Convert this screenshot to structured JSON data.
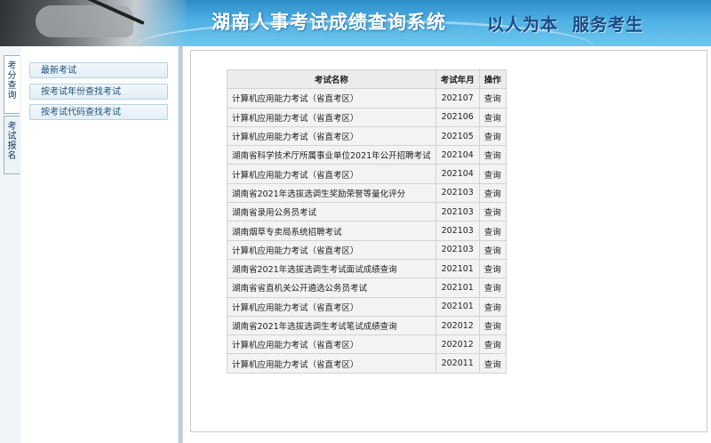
{
  "header": {
    "title": "湖南人事考试成绩查询系统",
    "slogan_left": "以人为本",
    "slogan_right": "服务考生"
  },
  "side_tabs": [
    "考分查询",
    "考试报名"
  ],
  "menu": {
    "items": [
      "最新考试",
      "按考试年份查找考试",
      "按考试代码查找考试"
    ]
  },
  "table": {
    "headers": [
      "考试名称",
      "考试年月",
      "操作"
    ],
    "rows": [
      [
        "计算机应用能力考试（省直考区）",
        "202107",
        "查询"
      ],
      [
        "计算机应用能力考试（省直考区）",
        "202106",
        "查询"
      ],
      [
        "计算机应用能力考试（省直考区）",
        "202105",
        "查询"
      ],
      [
        "湖南省科学技术厅所属事业单位2021年公开招聘考试",
        "202104",
        "查询"
      ],
      [
        "计算机应用能力考试（省直考区）",
        "202104",
        "查询"
      ],
      [
        "湖南省2021年选拔选调生奖励荣誉等量化评分",
        "202103",
        "查询"
      ],
      [
        "湖南省录用公务员考试",
        "202103",
        "查询"
      ],
      [
        "湖南烟草专卖局系统招聘考试",
        "202103",
        "查询"
      ],
      [
        "计算机应用能力考试（省直考区）",
        "202103",
        "查询"
      ],
      [
        "湖南省2021年选拔选调生考试面试成绩查询",
        "202101",
        "查询"
      ],
      [
        "湖南省省直机关公开遴选公务员考试",
        "202101",
        "查询"
      ],
      [
        "计算机应用能力考试（省直考区）",
        "202101",
        "查询"
      ],
      [
        "湖南省2021年选拔选调生考试笔试成绩查询",
        "202012",
        "查询"
      ],
      [
        "计算机应用能力考试（省直考区）",
        "202012",
        "查询"
      ],
      [
        "计算机应用能力考试（省直考区）",
        "202011",
        "查询"
      ]
    ]
  },
  "colors": {
    "header_blue": "#4fb1e4",
    "slogan": "#184a86",
    "menu_text": "#1f4f7a"
  }
}
